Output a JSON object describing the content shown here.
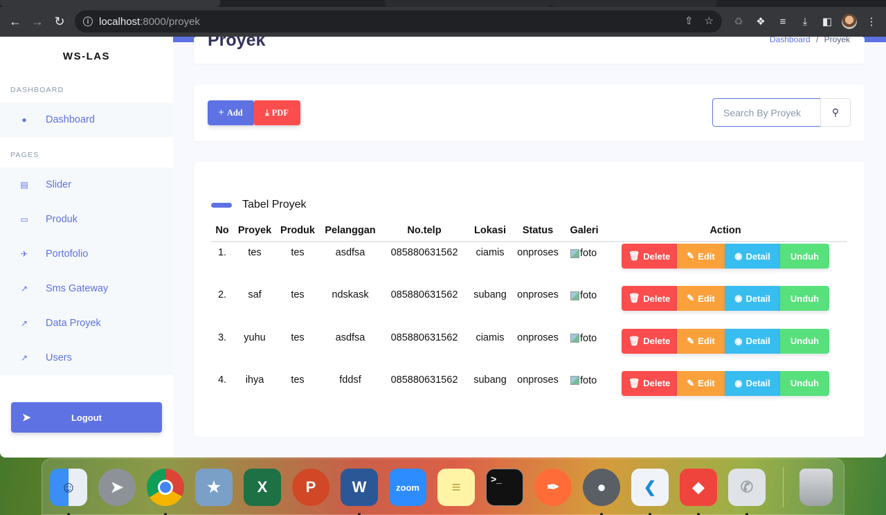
{
  "browser": {
    "url_host": "localhost",
    "url_rest": ":8000/proyek"
  },
  "sidebar": {
    "brand": "WS-LAS",
    "section_dashboard": "DASHBOARD",
    "section_pages": "PAGES",
    "items": [
      {
        "label": "Dashboard",
        "icon": "flame-icon"
      },
      {
        "label": "Slider",
        "icon": "id-card-icon"
      },
      {
        "label": "Produk",
        "icon": "folder-open-icon"
      },
      {
        "label": "Portofolio",
        "icon": "plane-icon"
      },
      {
        "label": "Sms Gateway",
        "icon": "chart-line-icon"
      },
      {
        "label": "Data Proyek",
        "icon": "chart-line-icon"
      },
      {
        "label": "Users",
        "icon": "chart-line-icon"
      }
    ],
    "logout": "Logout"
  },
  "header": {
    "title": "Proyek",
    "breadcrumb_link": "Dashboard",
    "breadcrumb_sep": "/",
    "breadcrumb_current": "Proyek"
  },
  "toolbar": {
    "add": "Add",
    "pdf": "PDF",
    "search_placeholder": "Search By Proyek"
  },
  "table": {
    "title": "Tabel Proyek",
    "columns": [
      "No",
      "Proyek",
      "Produk",
      "Pelanggan",
      "No.telp",
      "Lokasi",
      "Status",
      "Galeri",
      "Action"
    ],
    "rows": [
      {
        "no": "1.",
        "proyek": "tes",
        "produk": "tes",
        "pelanggan": "asdfsa",
        "telp": "085880631562",
        "lokasi": "ciamis",
        "status": "onproses",
        "galeri": "foto"
      },
      {
        "no": "2.",
        "proyek": "saf",
        "produk": "tes",
        "pelanggan": "ndskask",
        "telp": "085880631562",
        "lokasi": "subang",
        "status": "onproses",
        "galeri": "foto"
      },
      {
        "no": "3.",
        "proyek": "yuhu",
        "produk": "tes",
        "pelanggan": "asdfsa",
        "telp": "085880631562",
        "lokasi": "ciamis",
        "status": "onproses",
        "galeri": "foto"
      },
      {
        "no": "4.",
        "proyek": "ihya",
        "produk": "tes",
        "pelanggan": "fddsf",
        "telp": "085880631562",
        "lokasi": "subang",
        "status": "onproses",
        "galeri": "foto"
      }
    ],
    "actions": {
      "delete": "Delete",
      "edit": "Edit",
      "detail": "Detail",
      "unduh": "Unduh"
    }
  },
  "colors": {
    "primary": "#5e72e4",
    "danger": "#f5365c",
    "warning": "#fb8c3c",
    "info": "#11cdef",
    "success": "#2dce89"
  },
  "dock": [
    "finder",
    "launchpad",
    "chrome",
    "preview",
    "excel",
    "powerpoint",
    "word",
    "zoom",
    "notes",
    "terminal",
    "postman",
    "mamp",
    "vscode",
    "anydesk",
    "whatsapp",
    "trash"
  ]
}
